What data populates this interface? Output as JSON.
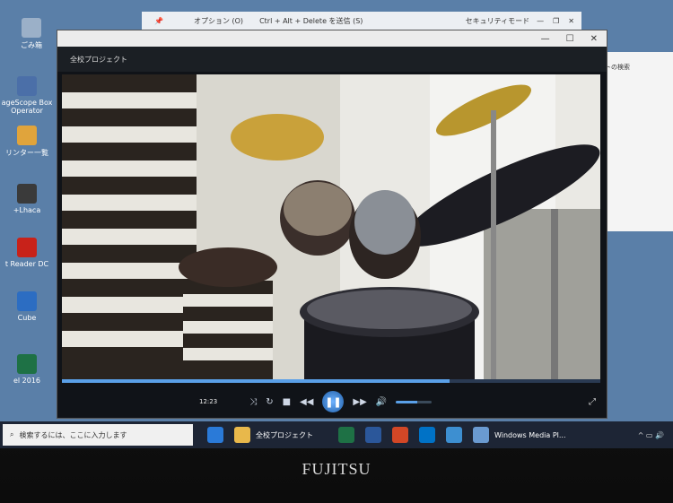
{
  "rdp_bar": {
    "options": "オプション (O)",
    "send": "Ctrl + Alt + Delete を送信 (S)",
    "mode": "セキュリティモード"
  },
  "desktop_icons": [
    "ごみ箱",
    "ageScope Box Operator",
    "リンター一覧",
    "+Lhaca",
    "t Reader DC",
    "Cube",
    "el 2016"
  ],
  "wmp": {
    "title": "全校プロジェクト",
    "time": "12:23",
    "progress": 0.72,
    "volume": 0.6
  },
  "explorer": {
    "search_hint": "クトの検索"
  },
  "taskbar": {
    "search_placeholder": "検索するには、ここに入力します",
    "folder_label": "全校プロジェクト",
    "wmp_label": "Windows Media Pl..."
  },
  "brand": "FUJITSU"
}
